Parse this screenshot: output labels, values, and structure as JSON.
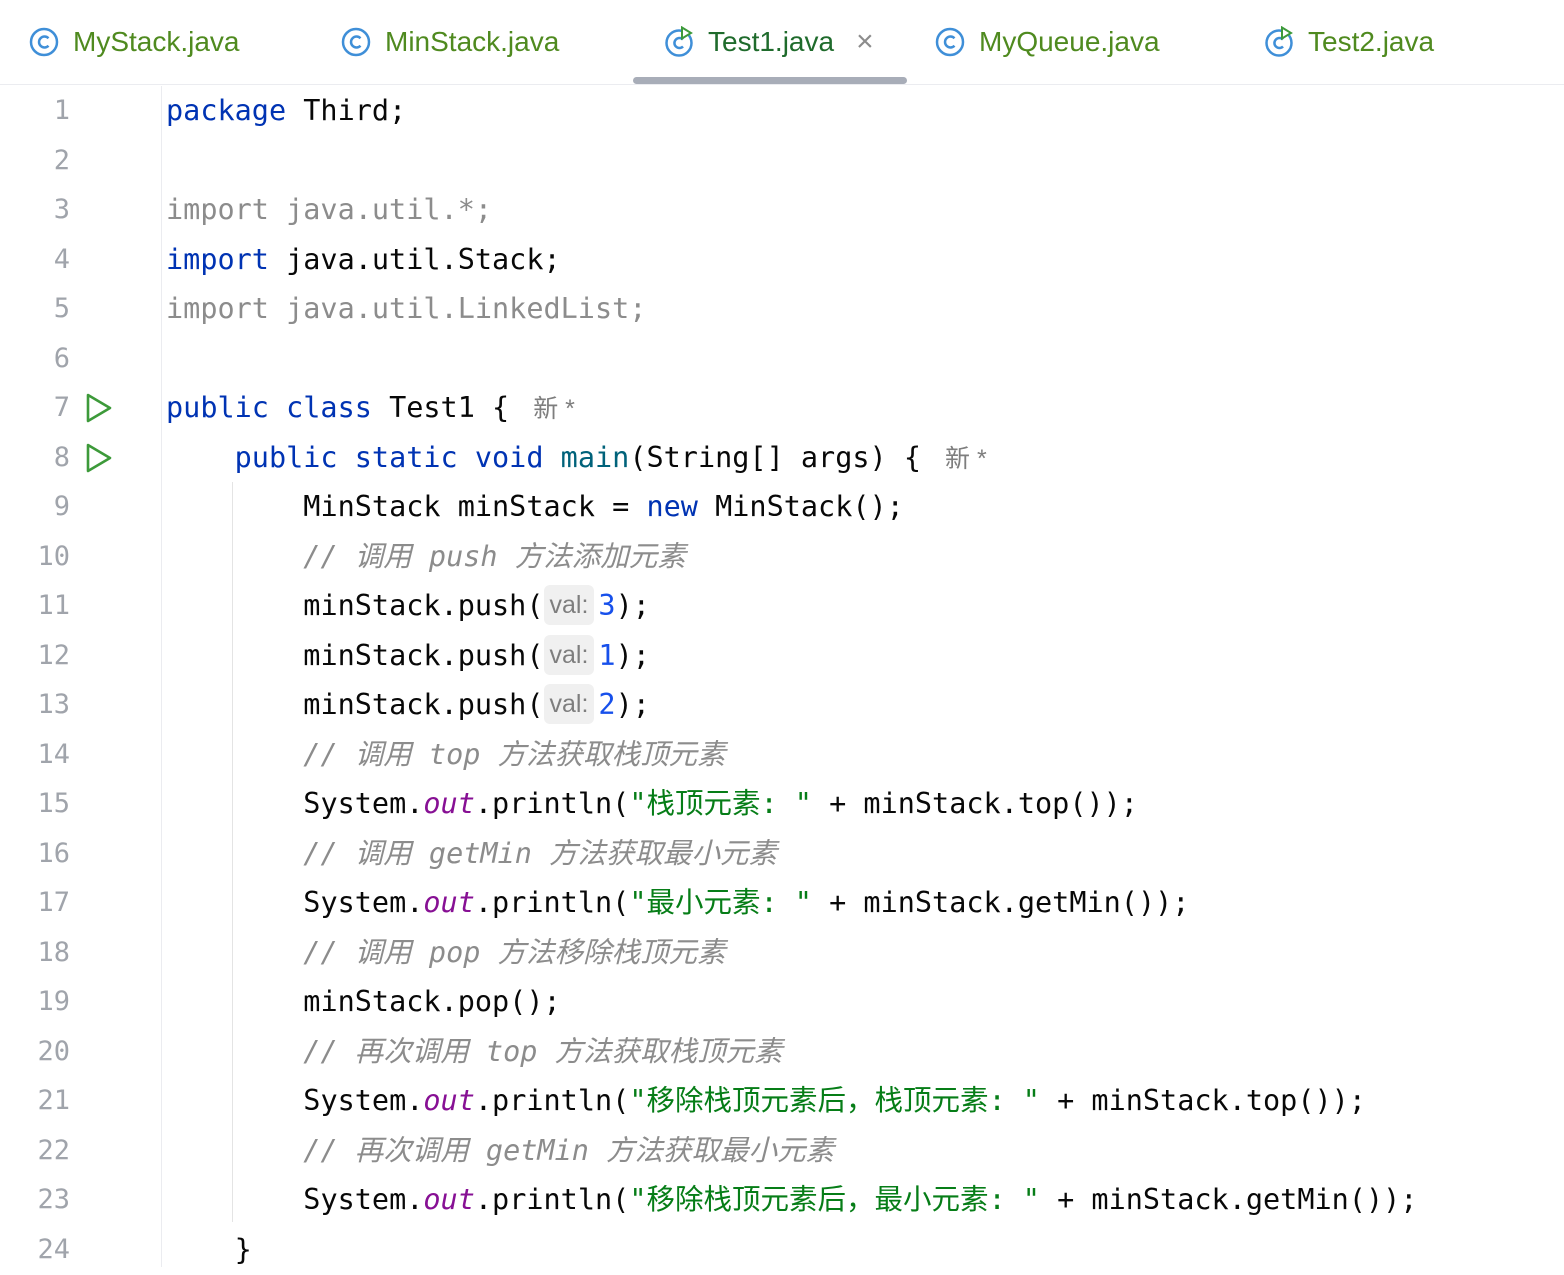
{
  "tabs": [
    {
      "label": "MyStack.java",
      "icon": "class-icon",
      "active": false
    },
    {
      "label": "MinStack.java",
      "icon": "class-icon",
      "active": false
    },
    {
      "label": "Test1.java",
      "icon": "runnable-class-icon",
      "active": true,
      "close": "×"
    },
    {
      "label": "MyQueue.java",
      "icon": "class-icon",
      "active": false
    },
    {
      "label": "Test2.java",
      "icon": "runnable-class-icon",
      "active": false
    }
  ],
  "code": {
    "line_numbers": [
      "1",
      "2",
      "3",
      "4",
      "5",
      "6",
      "7",
      "8",
      "9",
      "10",
      "11",
      "12",
      "13",
      "14",
      "15",
      "16",
      "17",
      "18",
      "19",
      "20",
      "21",
      "22",
      "23",
      "24"
    ],
    "l1": {
      "kw": "package",
      "rest": " Third;"
    },
    "l3": "import java.util.*;",
    "l4": {
      "kw": "import",
      "rest": " java.util.Stack;"
    },
    "l5": "import java.util.LinkedList;",
    "l7": {
      "kw": "public class",
      "rest": " Test1 {",
      "author": "新 *"
    },
    "l8": {
      "kw": "public static void",
      "fn": "main",
      "rest": "(String[] args) {",
      "author": "新 *"
    },
    "l9": {
      "a": "MinStack minStack = ",
      "kw": "new",
      "b": " MinStack();"
    },
    "l10": "// 调用 push 方法添加元素",
    "l11": {
      "a": "minStack.push(",
      "hint": "val:",
      "num": "3",
      "b": ");"
    },
    "l12": {
      "a": "minStack.push(",
      "hint": "val:",
      "num": "1",
      "b": ");"
    },
    "l13": {
      "a": "minStack.push(",
      "hint": "val:",
      "num": "2",
      "b": ");"
    },
    "l14": "// 调用 top 方法获取栈顶元素",
    "l15": {
      "a": "System.",
      "field": "out",
      "b": ".println(",
      "str": "\"栈顶元素: \"",
      "c": " + minStack.top());"
    },
    "l16": "// 调用 getMin 方法获取最小元素",
    "l17": {
      "a": "System.",
      "field": "out",
      "b": ".println(",
      "str": "\"最小元素: \"",
      "c": " + minStack.getMin());"
    },
    "l18": "// 调用 pop 方法移除栈顶元素",
    "l19": "minStack.pop();",
    "l20": "// 再次调用 top 方法获取栈顶元素",
    "l21": {
      "a": "System.",
      "field": "out",
      "b": ".println(",
      "str": "\"移除栈顶元素后，栈顶元素: \"",
      "c": " + minStack.top());"
    },
    "l22": "// 再次调用 getMin 方法获取最小元素",
    "l23": {
      "a": "System.",
      "field": "out",
      "b": ".println(",
      "str": "\"移除栈顶元素后，最小元素: \"",
      "c": " + minStack.getMin());"
    },
    "l24": "}"
  },
  "colors": {
    "keyword": "#0033b3",
    "string": "#067d17",
    "field": "#871094",
    "comment": "#8c8c8c",
    "number": "#1750eb",
    "run": "#3d9a3a"
  }
}
